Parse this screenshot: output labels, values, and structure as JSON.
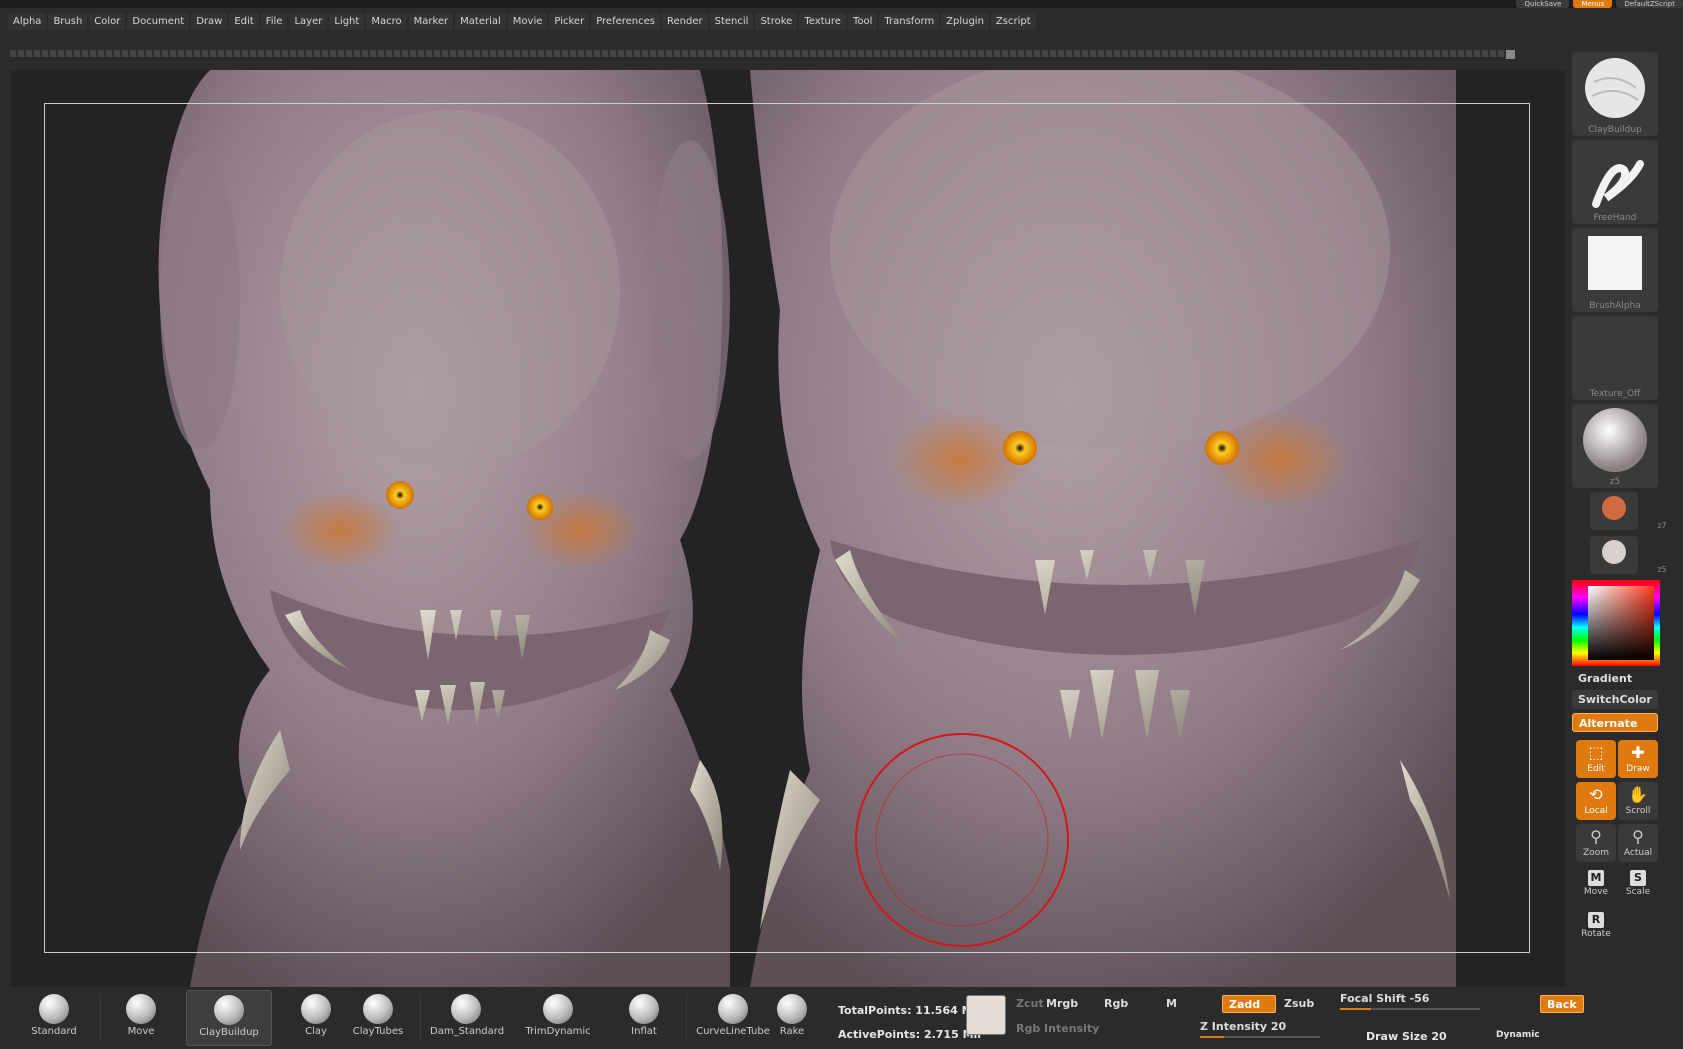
{
  "topbar": {
    "quicksave": "QuickSave",
    "menus": "Menus",
    "script": "DefaultZScript"
  },
  "menu": [
    "Alpha",
    "Brush",
    "Color",
    "Document",
    "Draw",
    "Edit",
    "File",
    "Layer",
    "Light",
    "Macro",
    "Marker",
    "Material",
    "Movie",
    "Picker",
    "Preferences",
    "Render",
    "Stencil",
    "Stroke",
    "Texture",
    "Tool",
    "Transform",
    "Zplugin",
    "Zscript"
  ],
  "colors": {
    "accent": "#e07a10",
    "clay": "#9a8790",
    "eye": "#ffb000",
    "brush_ring": "#d01818"
  },
  "tray": {
    "brush_caption": "ClayBuildup",
    "stroke_caption": "FreeHand",
    "alpha_caption": "BrushAlpha",
    "texture_caption": "Texture_Off",
    "material_caption": "z5",
    "material2_caption": "z7",
    "material3_caption": "z5",
    "gradient": "Gradient",
    "switchcolor": "SwitchColor",
    "alternate": "Alternate",
    "edit": "Edit",
    "draw": "Draw",
    "local": "Local",
    "scroll": "Scroll",
    "zoom": "Zoom",
    "actual": "Actual",
    "move": "Move",
    "scale": "Scale",
    "rotate": "Rotate"
  },
  "brushes": [
    "Standard",
    "Move",
    "ClayBuildup",
    "Clay",
    "ClayTubes",
    "Dam_Standard",
    "TrimDynamic",
    "Inflat",
    "CurveLineTube",
    "Rake"
  ],
  "stats": {
    "total_points": "TotalPoints: 11.564 Mil",
    "active_points": "ActivePoints: 2.715 Mil"
  },
  "modes": {
    "zcut": "Zcut",
    "mrgb": "Mrgb",
    "rgb": "Rgb",
    "m": "M",
    "zadd": "Zadd",
    "zsub": "Zsub",
    "rgb_intensity": "Rgb Intensity"
  },
  "sliders": {
    "focal_shift": "Focal Shift -56",
    "z_intensity": "Z Intensity 20",
    "draw_size": "Draw Size 20",
    "dynamic": "Dynamic",
    "backface": "Back"
  }
}
